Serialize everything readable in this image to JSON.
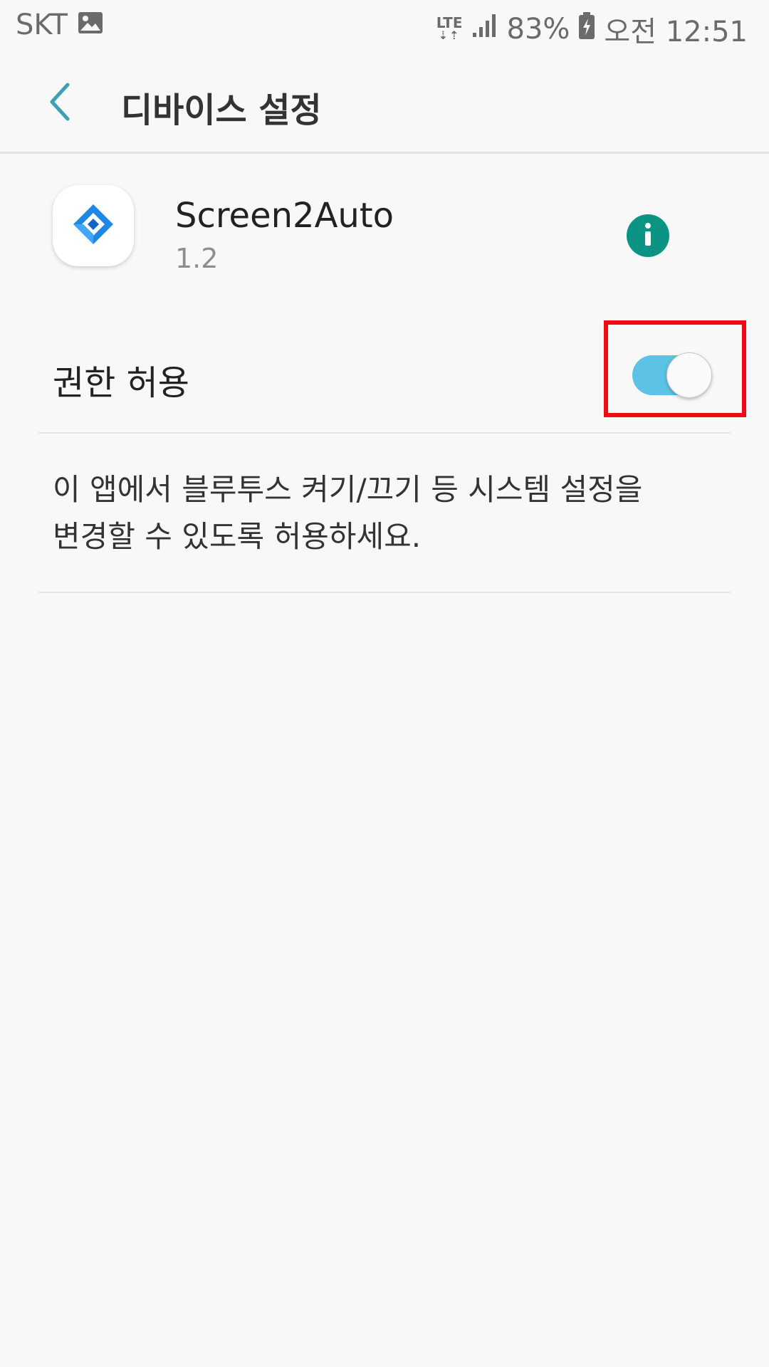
{
  "status_bar": {
    "carrier": "SKT",
    "network": "LTE",
    "battery": "83%",
    "time": "오전 12:51",
    "icons": [
      "image-icon",
      "lte-icon",
      "signal-icon",
      "battery-charging-icon"
    ]
  },
  "app_bar": {
    "back_icon": "chevron-left-icon",
    "title": "디바이스 설정"
  },
  "app_info": {
    "name": "Screen2Auto",
    "version": "1.2",
    "info_icon": "info-icon"
  },
  "permission": {
    "label": "권한 허용",
    "enabled": true
  },
  "description": {
    "line1": "이 앱에서 블루투스 켜기/끄기 등 시스템 설정을",
    "line2": "변경할 수 있도록 허용하세요."
  },
  "colors": {
    "accent": "#5cc3e6",
    "back_arrow": "#3f9fb6",
    "info_button": "#0b9484",
    "highlight": "#ef0a14",
    "background": "#f8f8f8"
  }
}
